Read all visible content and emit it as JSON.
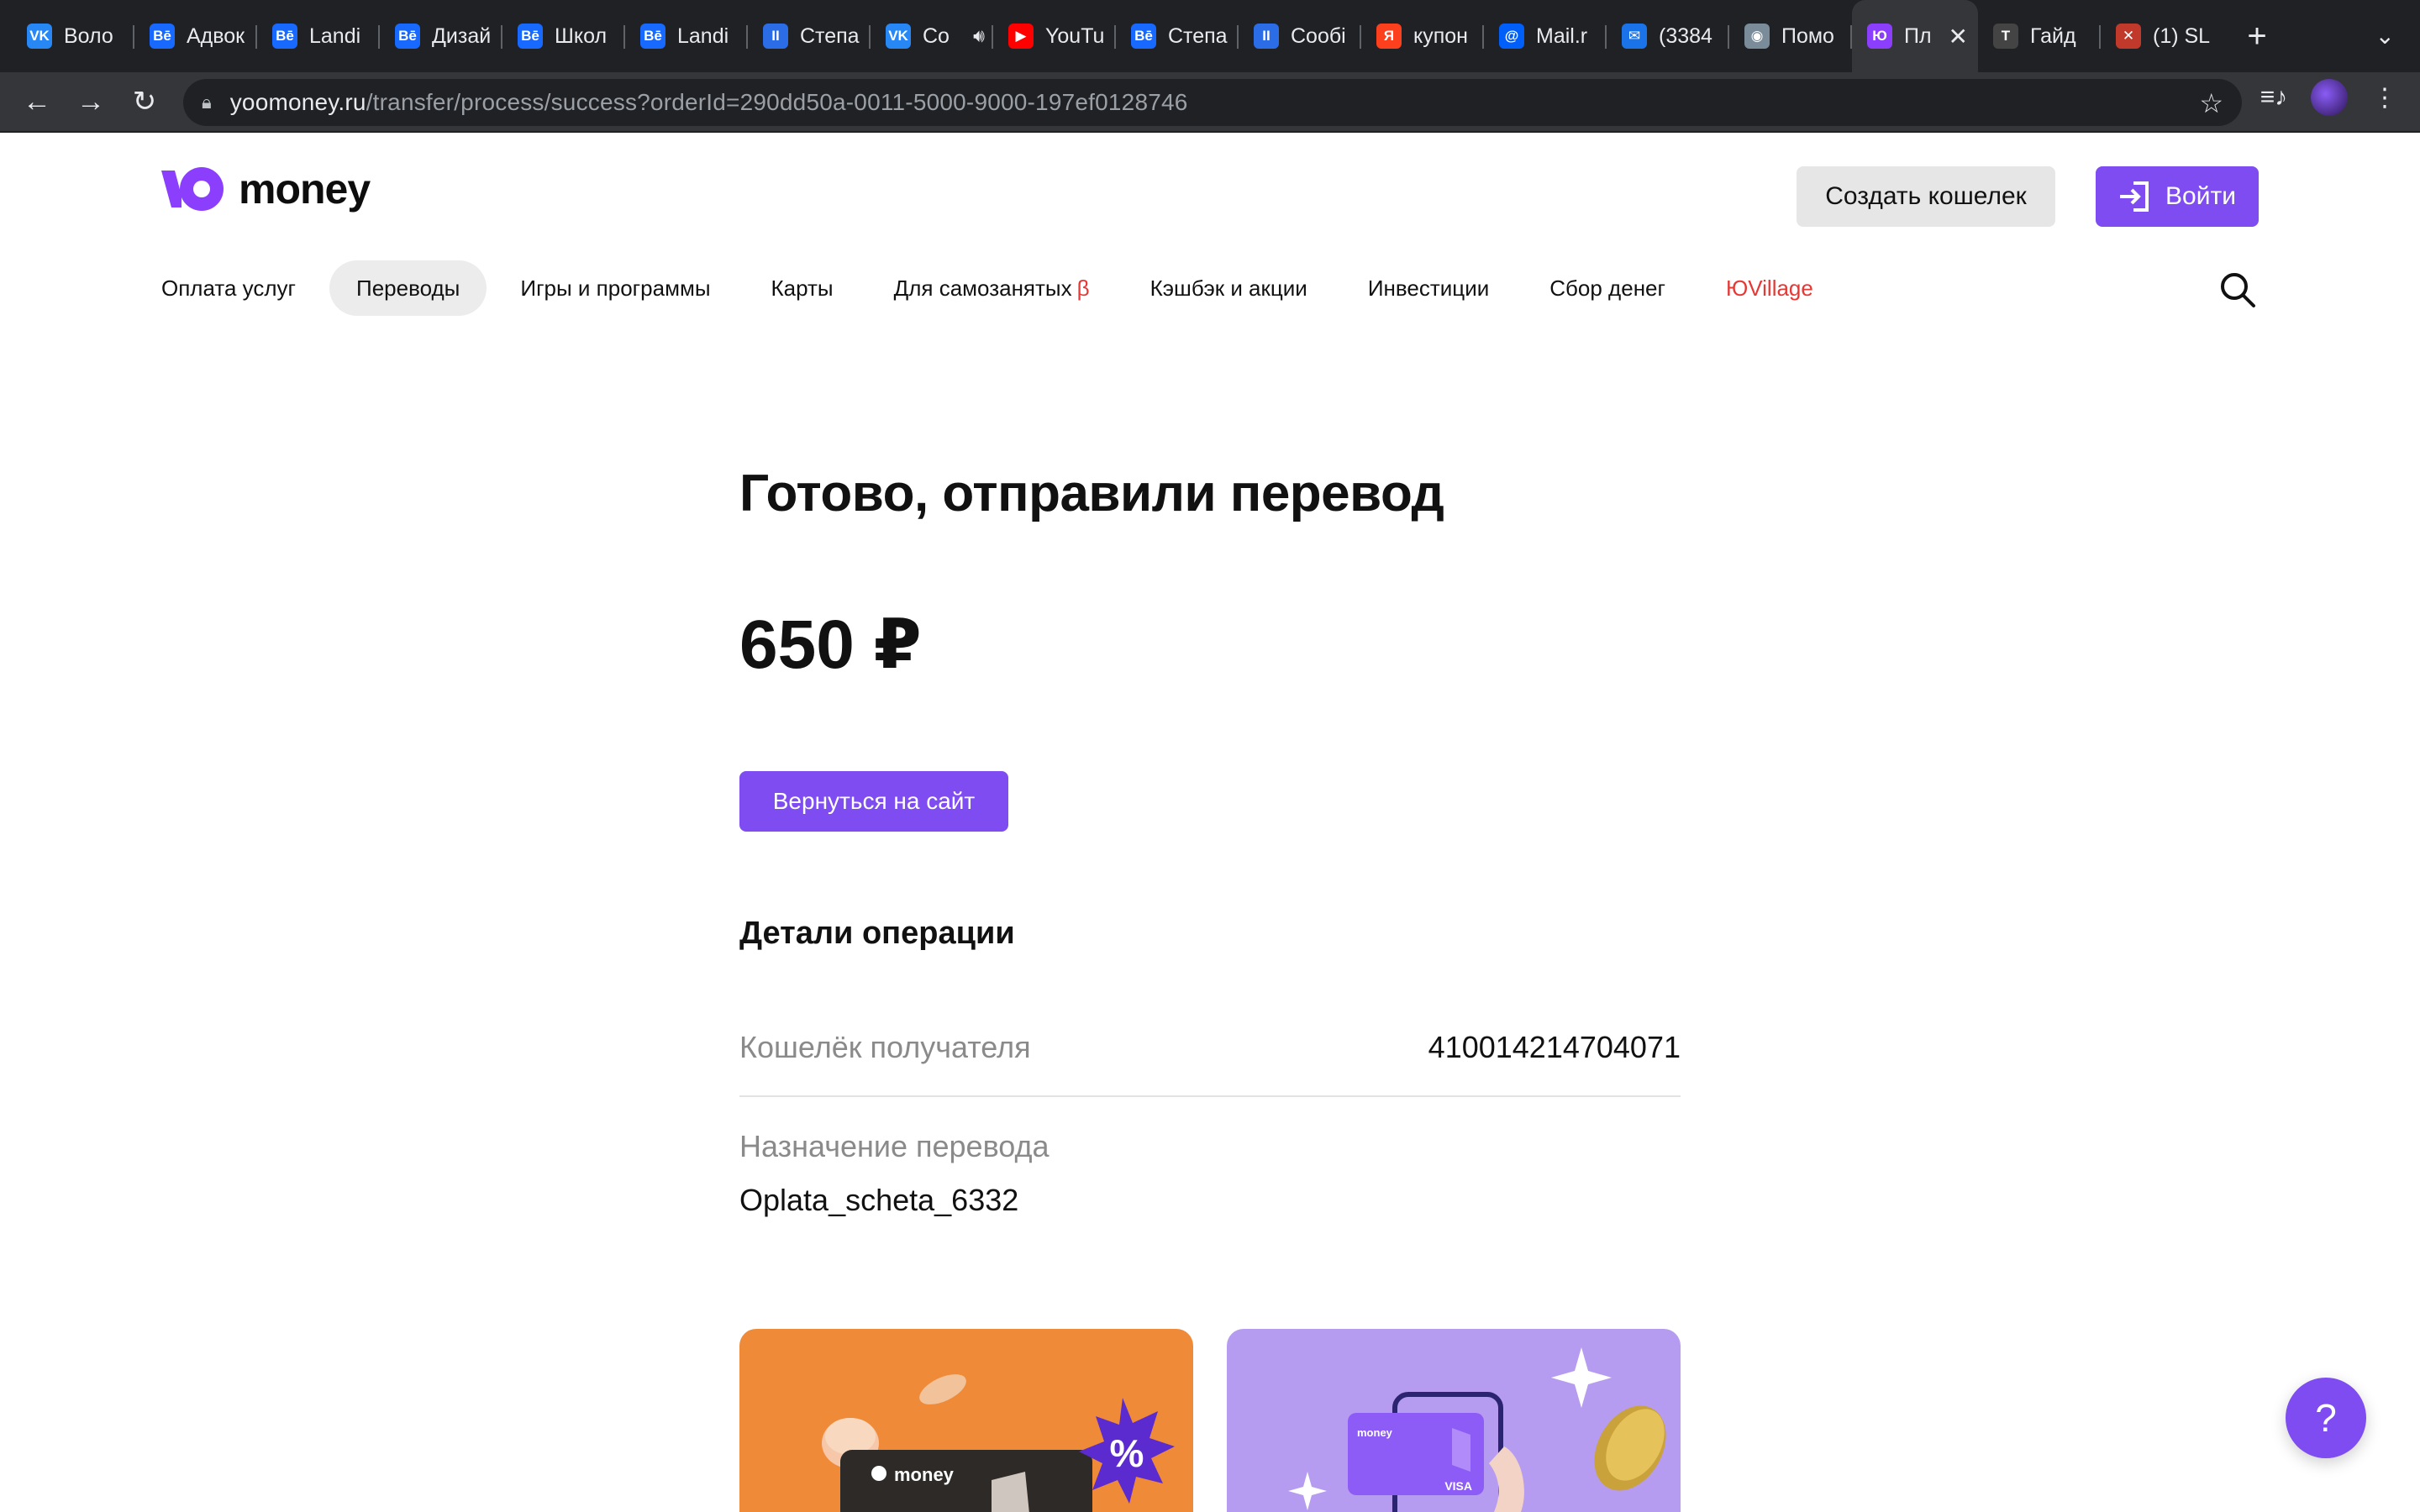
{
  "browser": {
    "tabs": [
      {
        "title": "Воло",
        "favicon": "VK",
        "color": "#2787f5"
      },
      {
        "title": "Адвок",
        "favicon": "Bē",
        "color": "#1769ff"
      },
      {
        "title": "Landi",
        "favicon": "Bē",
        "color": "#1769ff"
      },
      {
        "title": "Дизай",
        "favicon": "Bē",
        "color": "#1769ff"
      },
      {
        "title": "Школ",
        "favicon": "Bē",
        "color": "#1769ff"
      },
      {
        "title": "Landi",
        "favicon": "Bē",
        "color": "#1769ff"
      },
      {
        "title": "Степа",
        "favicon": "II",
        "color": "#2a6de6"
      },
      {
        "title": "Со",
        "favicon": "VK",
        "color": "#2787f5"
      },
      {
        "title": "YouTu",
        "favicon": "▶",
        "color": "#ff0000"
      },
      {
        "title": "Степа",
        "favicon": "Bē",
        "color": "#1769ff"
      },
      {
        "title": "Сообі",
        "favicon": "II",
        "color": "#2a6de6"
      },
      {
        "title": "купон",
        "favicon": "Я",
        "color": "#fc3f1d"
      },
      {
        "title": "Mail.r",
        "favicon": "@",
        "color": "#005ff9"
      },
      {
        "title": "(3384",
        "favicon": "✉",
        "color": "#1a73e8"
      },
      {
        "title": "Помо",
        "favicon": "◉",
        "color": "#7a8c99"
      },
      {
        "title": "Пл",
        "favicon": "Ю",
        "color": "#8b3ffd"
      },
      {
        "title": "Гайд",
        "favicon": "T",
        "color": "#444444"
      },
      {
        "title": "(1) SL",
        "favicon": "✕",
        "color": "#c0392b"
      }
    ],
    "url_host": "yoomoney.ru",
    "url_path": "/transfer/process/success?orderId=290dd50a-0011-5000-9000-197ef0128746"
  },
  "header": {
    "logo_text": "money",
    "create_wallet": "Создать кошелек",
    "login": "Войти"
  },
  "nav": {
    "items": [
      {
        "label": "Оплата услуг"
      },
      {
        "label": "Переводы"
      },
      {
        "label": "Игры и программы"
      },
      {
        "label": "Карты"
      },
      {
        "label": "Для самозанятых",
        "badge": "β"
      },
      {
        "label": "Кэшбэк и акции"
      },
      {
        "label": "Инвестиции"
      },
      {
        "label": "Сбор денег"
      },
      {
        "label": "ЮVillage"
      }
    ],
    "active": "Переводы"
  },
  "result": {
    "title": "Готово, отправили перевод",
    "amount": "650 ₽",
    "return_button": "Вернуться на сайт"
  },
  "details": {
    "title": "Детали операции",
    "wallet_label": "Кошелёк получателя",
    "wallet_value": "410014214704071",
    "purpose_label": "Назначение перевода",
    "purpose_value": "Oplata_scheta_6332"
  },
  "promo": {
    "card_logo_text": "money",
    "percent_badge": "%",
    "card_brand": "VISA"
  },
  "help": {
    "label": "?"
  },
  "colors": {
    "brand": "#7e4cf0",
    "accent_red": "#e53935"
  }
}
